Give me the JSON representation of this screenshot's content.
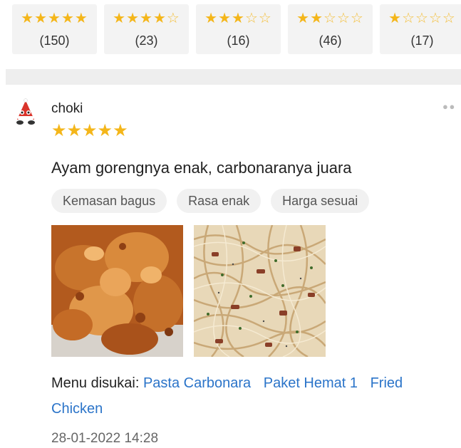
{
  "rating_filters": [
    {
      "stars": 5,
      "count": "(150)"
    },
    {
      "stars": 4,
      "count": "(23)"
    },
    {
      "stars": 3,
      "count": "(16)"
    },
    {
      "stars": 2,
      "count": "(46)"
    },
    {
      "stars": 1,
      "count": "(17)"
    }
  ],
  "review": {
    "username": "choki",
    "rating": 5,
    "comment": "Ayam gorengnya enak, carbonaranya juara",
    "tags": [
      "Kemasan bagus",
      "Rasa enak",
      "Harga sesuai"
    ],
    "photos": [
      "fried-chicken-photo",
      "pasta-carbonara-photo"
    ],
    "menu_label": "Menu disukai:",
    "liked_menu": [
      "Pasta Carbonara",
      "Paket Hemat 1",
      "Fried Chicken"
    ],
    "date": "28-01-2022 14:28"
  },
  "colors": {
    "star": "#f4b61a",
    "link": "#2b74c9",
    "chip_bg": "#f3f3f3"
  },
  "icons": {
    "more": "more-dots-icon",
    "star": "star-icon"
  }
}
